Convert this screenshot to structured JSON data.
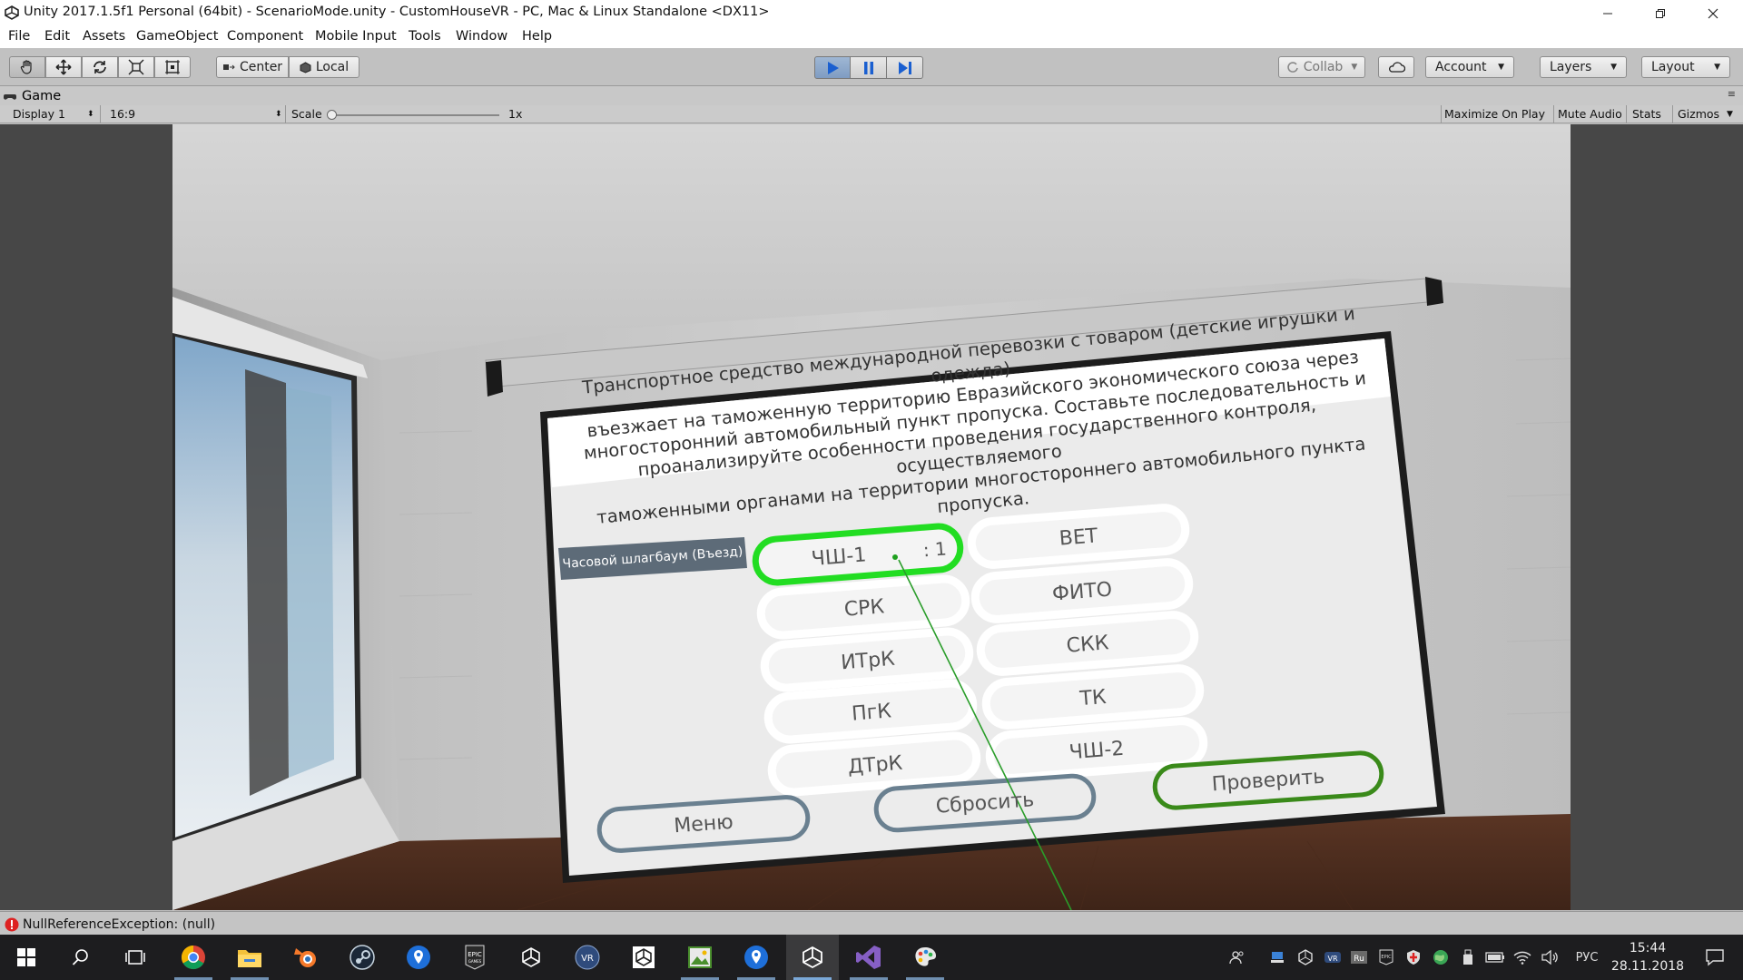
{
  "window": {
    "title": "Unity 2017.1.5f1 Personal (64bit) - ScenarioMode.unity - CustomHouseVR - PC, Mac & Linux Standalone <DX11>",
    "minimize_icon": "minimize-icon",
    "maximize_icon": "restore-icon",
    "close_icon": "close-icon"
  },
  "menu": [
    "File",
    "Edit",
    "Assets",
    "GameObject",
    "Component",
    "Mobile Input",
    "Tools",
    "Window",
    "Help"
  ],
  "toolbar": {
    "tools": [
      "hand-tool-icon",
      "move-tool-icon",
      "rotate-tool-icon",
      "scale-tool-icon",
      "rect-tool-icon"
    ],
    "pivot": "Center",
    "space": "Local",
    "collab": "Collab",
    "account": "Account",
    "layers": "Layers",
    "layout": "Layout",
    "play_active": true
  },
  "game_tab": {
    "label": "Game",
    "display": "Display 1",
    "aspect": "16:9",
    "scale_label": "Scale",
    "scale_value": "1x",
    "options": [
      "Maximize On Play",
      "Mute Audio",
      "Stats",
      "Gizmos"
    ]
  },
  "scene": {
    "question": [
      "Транспортное средство международной перевозки с товаром (детские игрушки и одежда)",
      "въезжает на таможенную территорию Евразийского экономического союза через",
      "многосторонний автомобильный пункт пропуска. Составьте последовательность и",
      "проанализируйте особенности проведения государственного контроля, осуществляемого",
      "таможенными органами на территории многостороннего автомобильного пункта пропуска."
    ],
    "tag_label": "Часовой шлагбаум (Въезд)",
    "left_options": [
      "ЧШ-1",
      "СРК",
      "ИТрК",
      "ПгК",
      "ДТрК"
    ],
    "right_options": [
      "ВЕТ",
      "ФИТО",
      "СКК",
      "ТК",
      "ЧШ-2"
    ],
    "selected_option": "ЧШ-1",
    "selected_order": ": 1",
    "buttons": {
      "menu": "Меню",
      "reset": "Сбросить",
      "check": "Проверить"
    },
    "colors": {
      "selected": "#22dd22",
      "check": "#3a8a1a",
      "menu_reset": "#6a8090",
      "tag": "#5d6b78"
    }
  },
  "status": {
    "error_icon": "error-icon",
    "message": "NullReferenceException: (null)"
  },
  "taskbar": {
    "apps": [
      "windows-start-icon",
      "search-icon",
      "task-view-icon",
      "chrome-icon",
      "file-explorer-icon",
      "blender-icon",
      "steam-icon",
      "maps-pin-icon",
      "epic-games-icon",
      "unity-hub-icon",
      "vr-icon",
      "unity-icon",
      "image-editor-icon",
      "maps-pin-icon",
      "unity-editor-icon",
      "visual-studio-icon",
      "paint-icon"
    ],
    "tray_icons": [
      "people-icon",
      "network-drive-icon",
      "unity-tray-icon",
      "vr-tray-icon",
      "ru-keyboard-icon",
      "epic-tray-icon",
      "shield-icon",
      "globe-icon",
      "usb-icon",
      "battery-icon",
      "wifi-icon",
      "volume-icon"
    ],
    "language": "РУС",
    "time": "15:44",
    "date": "28.11.2018",
    "notifications_icon": "notifications-icon"
  }
}
